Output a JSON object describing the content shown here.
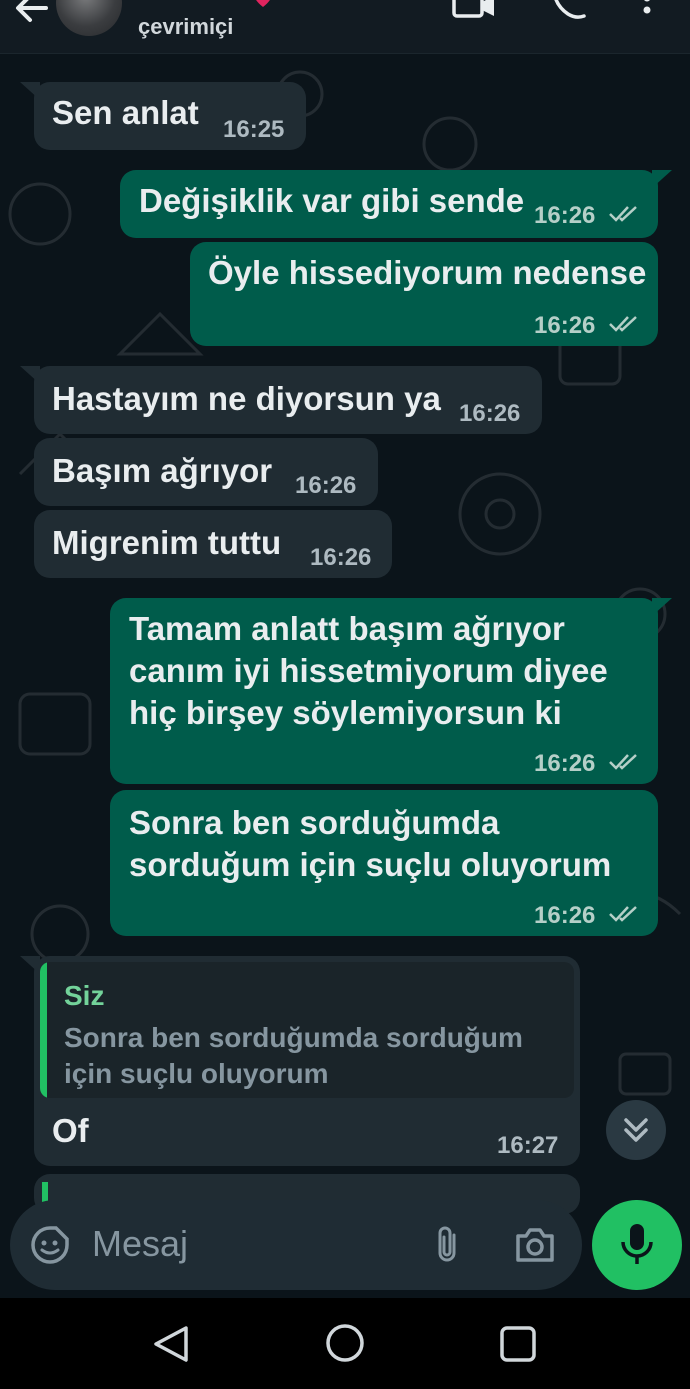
{
  "header": {
    "status": "çevrimiçi",
    "icons": [
      "back-arrow-icon",
      "heart-icon",
      "video-call-icon",
      "phone-icon",
      "more-options-icon"
    ]
  },
  "messages": [
    {
      "direction": "in",
      "text": "Sen anlat",
      "time": "16:25"
    },
    {
      "direction": "out",
      "text": "Değişiklik var gibi sende",
      "time": "16:26",
      "read": true
    },
    {
      "direction": "out",
      "text": "Öyle hissediyorum nedense",
      "time": "16:26",
      "read": true
    },
    {
      "direction": "in",
      "text": "Hastayım ne diyorsun ya",
      "time": "16:26"
    },
    {
      "direction": "in",
      "text": "Başım ağrıyor",
      "time": "16:26"
    },
    {
      "direction": "in",
      "text": "Migrenim tuttu",
      "time": "16:26"
    },
    {
      "direction": "out",
      "lines": [
        "Tamam anlatt başım ağrıyor",
        "canım iyi hissetmiyorum diyee",
        "hiç birşey söylemiyorsun ki"
      ],
      "time": "16:26",
      "read": true
    },
    {
      "direction": "out",
      "lines": [
        "Sonra ben sorduğumda",
        "sorduğum için suçlu oluyorum"
      ],
      "time": "16:26",
      "read": true
    },
    {
      "direction": "in",
      "quote": {
        "author": "Siz",
        "lines": [
          "Sonra ben sorduğumda sorduğum",
          "için suçlu oluyorum"
        ]
      },
      "text": "Of",
      "time": "16:27"
    }
  ],
  "composer": {
    "placeholder": "Mesaj",
    "icons": [
      "emoji-sticker-icon",
      "attach-icon",
      "camera-icon",
      "mic-icon"
    ]
  },
  "colors": {
    "background": "#0b141a",
    "incoming_bubble": "#202c33",
    "outgoing_bubble": "#005c4b",
    "accent_green": "#21c063",
    "read_ticks": "#b5cfc8"
  }
}
